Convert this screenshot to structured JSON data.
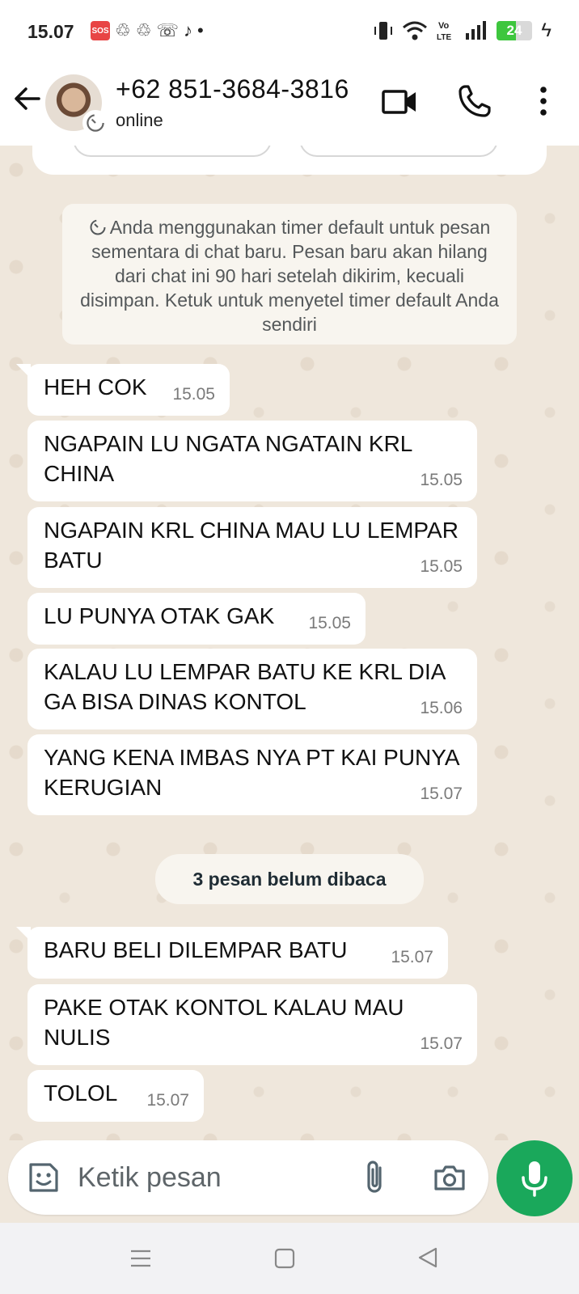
{
  "status_bar": {
    "time": "15.07",
    "sos_badge": "SOS",
    "battery_level": "24",
    "network_label": "Vo LTE"
  },
  "header": {
    "contact_name": "+62 851-3684-3816",
    "status": "online"
  },
  "notice": {
    "text": "Anda menggunakan timer default untuk pesan sementara di chat baru. Pesan baru akan hilang dari chat ini 90 hari setelah dikirim, kecuali disimpan. Ketuk untuk menyetel timer default Anda sendiri"
  },
  "messages": [
    {
      "text": "HEH COK",
      "time": "15.05"
    },
    {
      "text": "NGAPAIN LU NGATA NGATAIN KRL CHINA",
      "time": "15.05"
    },
    {
      "text": "NGAPAIN KRL CHINA MAU LU LEMPAR BATU",
      "time": "15.05"
    },
    {
      "text": "LU PUNYA OTAK GAK",
      "time": "15.05"
    },
    {
      "text": "KALAU LU LEMPAR BATU KE KRL DIA GA BISA DINAS KONTOL",
      "time": "15.06"
    },
    {
      "text": "YANG KENA IMBAS NYA PT KAI PUNYA KERUGIAN",
      "time": "15.07"
    }
  ],
  "unread_banner": "3 pesan belum dibaca",
  "messages_after": [
    {
      "text": "BARU BELI DILEMPAR BATU",
      "time": "15.07"
    },
    {
      "text": "PAKE OTAK KONTOL KALAU MAU NULIS",
      "time": "15.07"
    },
    {
      "text": "TOLOL",
      "time": "15.07"
    }
  ],
  "composer": {
    "placeholder": "Ketik pesan"
  },
  "colors": {
    "accent": "#1aa85b",
    "chat_bg": "#efe7dc",
    "bubble": "#ffffff"
  }
}
